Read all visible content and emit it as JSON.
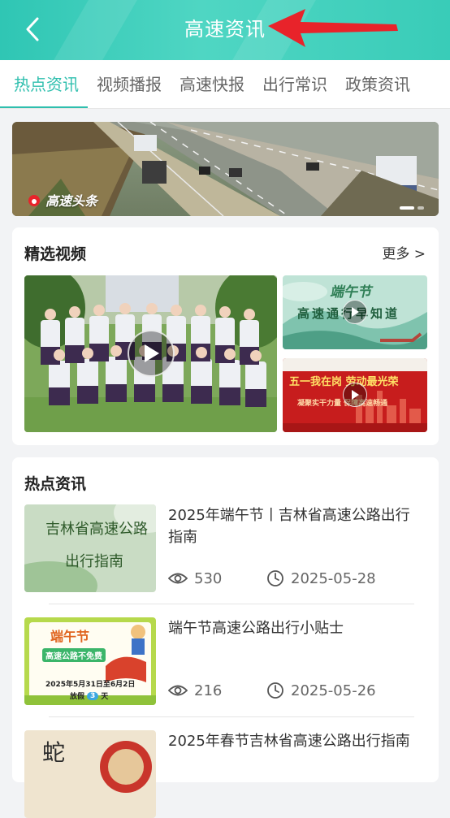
{
  "header": {
    "title": "高速资讯",
    "back_icon": "chevron-left-icon",
    "annotation_icon": "red-arrow-icon",
    "colors": {
      "header": "#3ccfbd",
      "accent": "#2fbfae",
      "arrow": "#e8232a"
    }
  },
  "tabs": [
    {
      "label": "热点资讯",
      "active": true
    },
    {
      "label": "视频播报",
      "active": false
    },
    {
      "label": "高速快报",
      "active": false
    },
    {
      "label": "出行常识",
      "active": false
    },
    {
      "label": "政策资讯",
      "active": false
    }
  ],
  "banner": {
    "logo_text": "高速头条",
    "slides": 2,
    "active_slide": 1
  },
  "videos": {
    "title": "精选视频",
    "more_label": "更多 >",
    "side1_title": "端午节",
    "side1_subtitle": "高速通行早知道",
    "side2_title": "五一我在岗 劳动最光荣",
    "side2_subtitle": "凝聚实干力量 保障高速畅通"
  },
  "news": {
    "title": "热点资讯",
    "items": [
      {
        "title": "2025年端午节丨吉林省高速公路出行指南",
        "views": "530",
        "date": "2025-05-28",
        "thumb_line1": "吉林省高速公路",
        "thumb_line2": "出行指南"
      },
      {
        "title": "端午节高速公路出行小贴士",
        "views": "216",
        "date": "2025-05-26",
        "thumb_title": "端午节",
        "thumb_sub": "高速公路不免费",
        "thumb_dates": "2025年5月31日至6月2日",
        "thumb_holiday_pre": "放假",
        "thumb_holiday_num": "3",
        "thumb_holiday_post": "天"
      },
      {
        "title": "2025年春节吉林省高速公路出行指南",
        "thumb_glyph": "蛇"
      }
    ]
  }
}
